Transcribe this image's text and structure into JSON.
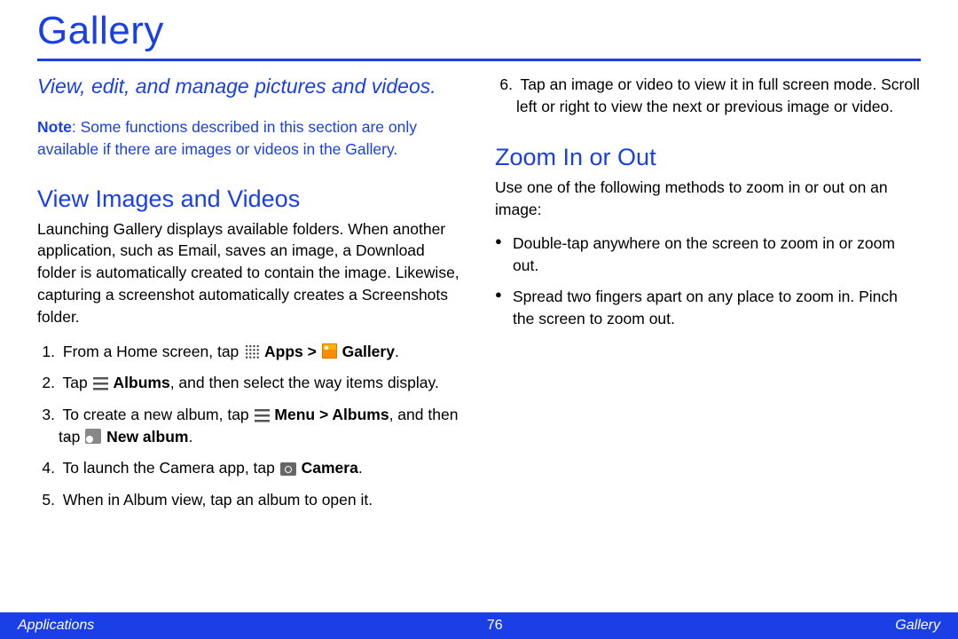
{
  "title": "Gallery",
  "subtitle": "View, edit, and manage pictures and videos.",
  "note_label": "Note",
  "note_body": ": Some functions described in this section are only available if there are images or videos in the Gallery.",
  "section_view": {
    "heading": "View Images and Videos",
    "intro": "Launching Gallery displays available folders. When another application, such as Email, saves an image, a Download folder is automatically created to contain the image. Likewise, capturing a screenshot automatically creates a Screenshots folder.",
    "steps": {
      "s1_a": "From a Home screen, tap ",
      "s1_apps": "Apps > ",
      "s1_gallery": " Gallery",
      "s1_end": ".",
      "s2_a": "Tap ",
      "s2_albums": " Albums",
      "s2_b": ", and then select the way items display.",
      "s3_a": "To create a new album, tap ",
      "s3_menu": " Menu > Albums",
      "s3_b": ", and then tap ",
      "s3_new": " New album",
      "s3_end": ".",
      "s4_a": "To launch the Camera app, tap ",
      "s4_cam": " Camera",
      "s4_end": ".",
      "s5": "When in Album view, tap an album to open it.",
      "s6": "Tap an image or video to view it in full screen mode. Scroll left or right to view the next or previous image or video."
    }
  },
  "section_zoom": {
    "heading": "Zoom In or Out",
    "intro": "Use one of the following methods to zoom in or out on an image:",
    "bullets": [
      "Double-tap anywhere on the screen to zoom in or zoom out.",
      "Spread two fingers apart on any place to zoom in. Pinch the screen to zoom out."
    ]
  },
  "footer": {
    "left": "Applications",
    "page": "76",
    "right": "Gallery"
  }
}
